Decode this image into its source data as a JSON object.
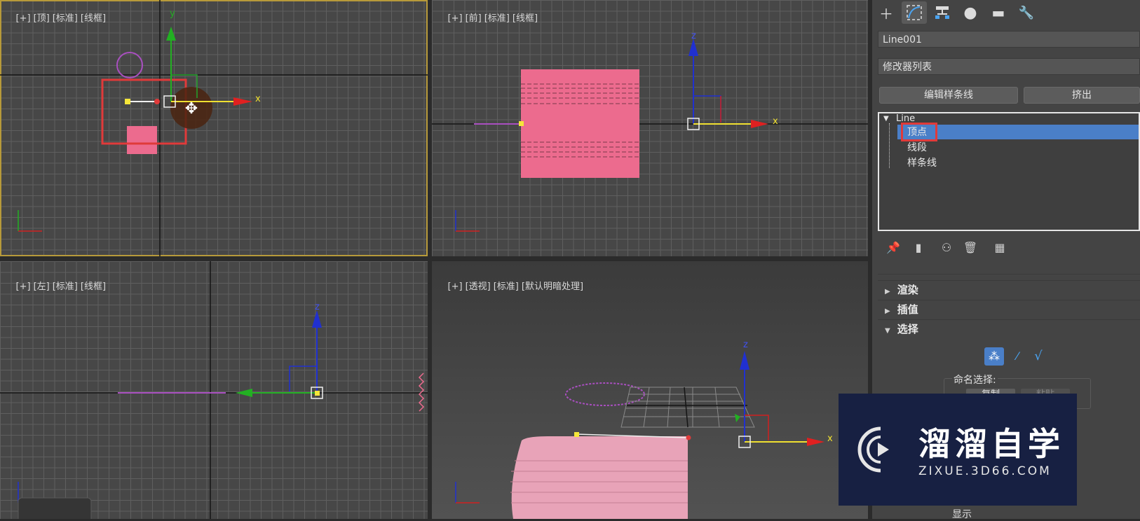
{
  "viewports": {
    "top": {
      "labels": [
        "[+]",
        "[顶]",
        "[标准]",
        "[线框]"
      ],
      "axis_x": "x",
      "axis_y": "y"
    },
    "front": {
      "labels": [
        "[+]",
        "[前]",
        "[标准]",
        "[线框]"
      ],
      "axis_x": "x",
      "axis_z": "z"
    },
    "left": {
      "labels": [
        "[+]",
        "[左]",
        "[标准]",
        "[线框]"
      ],
      "axis_z": "z"
    },
    "perspective": {
      "labels": [
        "[+]",
        "[透视]",
        "[标准]",
        "[默认明暗处理]"
      ],
      "axis_x": "x",
      "axis_z": "z"
    }
  },
  "command_panel": {
    "tabs": [
      "create-icon",
      "modify-icon",
      "hierarchy-icon",
      "motion-icon",
      "display-icon",
      "utilities-icon"
    ],
    "object_name": "Line001",
    "modifier_list": "修改器列表",
    "buttons": {
      "edit_spline": "编辑样条线",
      "extrude": "挤出"
    },
    "stack": {
      "root": "Line",
      "items": [
        "顶点",
        "线段",
        "样条线"
      ],
      "selected": "顶点"
    },
    "rollouts": {
      "render": "渲染",
      "interpolation": "插值",
      "selection": "选择"
    },
    "selection": {
      "named_selection": "命名选择:",
      "copy": "复制",
      "paste": "粘贴",
      "display": "显示"
    }
  },
  "watermark": {
    "title": "溜溜自学",
    "subtitle": "ZIXUE.3D66.COM"
  },
  "colors": {
    "highlight": "#4a7fc8",
    "accent_red": "#e03a3a",
    "object_pink": "#ec6b8e",
    "active_border": "#b79a3a"
  }
}
